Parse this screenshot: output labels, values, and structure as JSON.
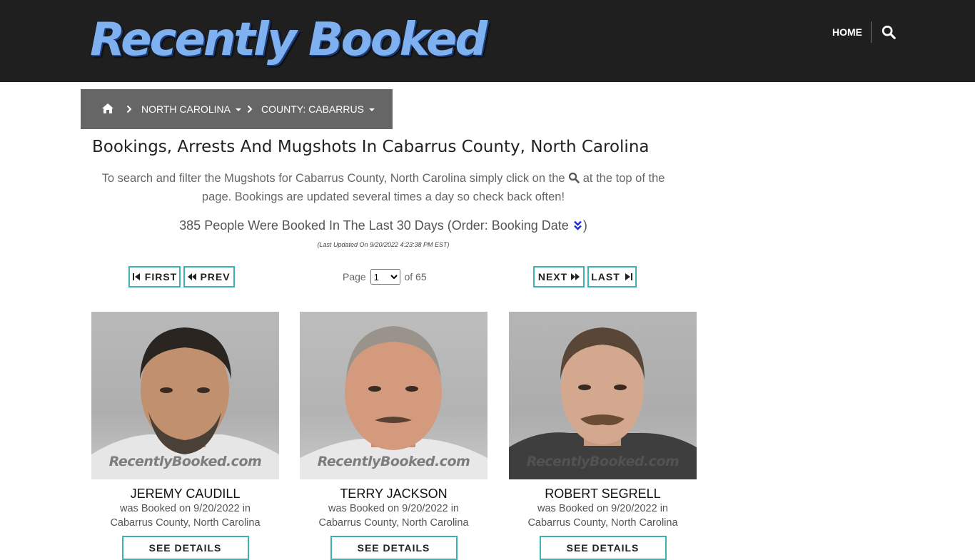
{
  "header": {
    "logo_text": "Recently Booked",
    "nav_home": "HOME",
    "search_icon": "search-icon"
  },
  "breadcrumb": {
    "home_icon": "home-icon",
    "state": "NORTH CAROLINA",
    "county": "COUNTY: CABARRUS"
  },
  "page": {
    "title": "Bookings, Arrests And Mugshots In Cabarrus County, North Carolina",
    "desc_part1": "To search and filter the Mugshots for Cabarrus County, North Carolina simply click on the",
    "desc_part2": "at the top of the page. Bookings are updated several times a day so check back often!",
    "count_text": "385 People Were Booked In The Last 30 Days (Order: Booking Date",
    "count_close": ")",
    "last_updated": "(Last Updated On 9/20/2022 4:23:38 PM EST)"
  },
  "pagination": {
    "first": "FIRST",
    "prev": "PREV",
    "next": "NEXT",
    "last": "LAST",
    "page_label": "Page",
    "current_page": "1",
    "of_label": "of 65"
  },
  "cards": [
    {
      "name": "JEREMY CAUDILL",
      "booked": "was Booked on 9/20/2022 in",
      "location": "Cabarrus County, North Carolina",
      "watermark": "RecentlyBooked.com",
      "button": "SEE DETAILS"
    },
    {
      "name": "TERRY JACKSON",
      "booked": "was Booked on 9/20/2022 in",
      "location": "Cabarrus County, North Carolina",
      "watermark": "RecentlyBooked.com",
      "button": "SEE DETAILS"
    },
    {
      "name": "ROBERT SEGRELL",
      "booked": "was Booked on 9/20/2022 in",
      "location": "Cabarrus County, North Carolina",
      "watermark": "RecentlyBooked.com",
      "button": "SEE DETAILS"
    }
  ],
  "colors": {
    "header_bg": "#1f1f1f",
    "breadcrumb_bg": "#666666",
    "accent": "#3bb3b3",
    "sort_icon": "#1a2fd6"
  }
}
